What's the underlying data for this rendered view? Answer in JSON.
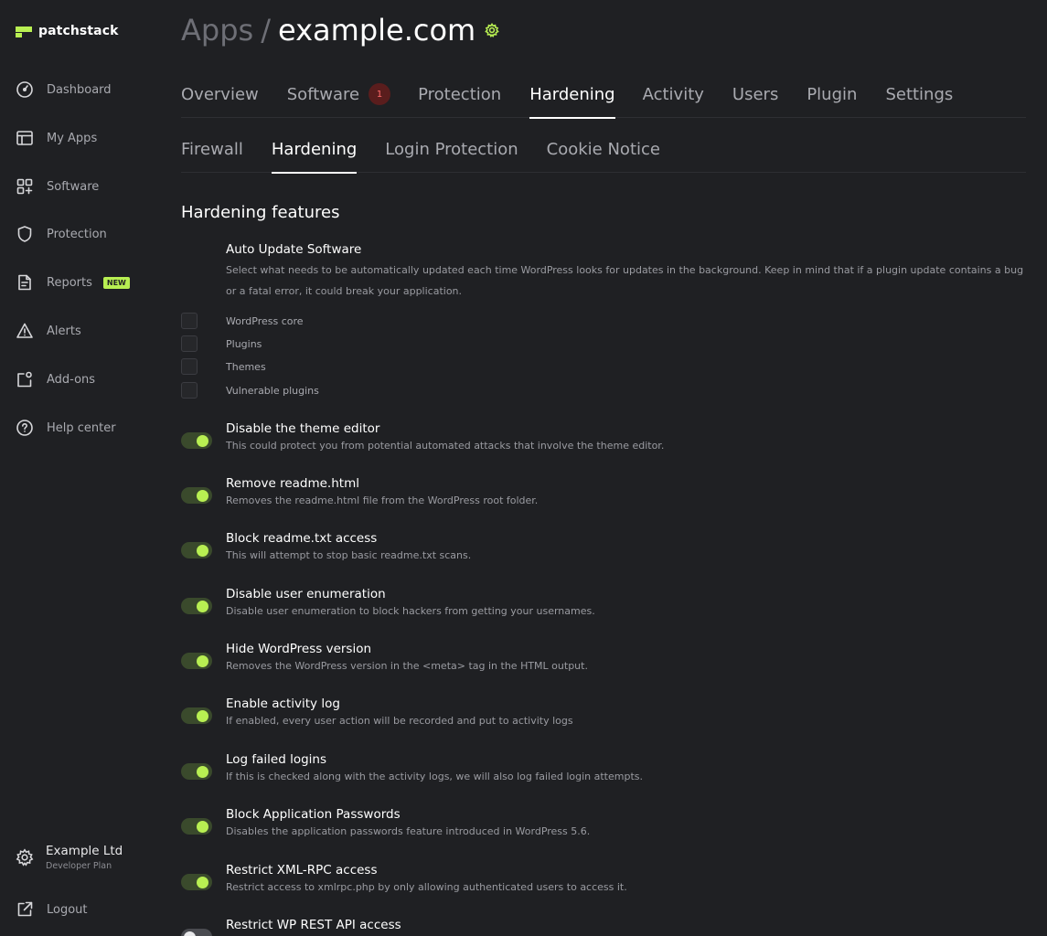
{
  "brand": {
    "name": "patchstack"
  },
  "sidebar": {
    "items": [
      {
        "label": "Dashboard",
        "icon": "dashboard-icon"
      },
      {
        "label": "My Apps",
        "icon": "apps-icon"
      },
      {
        "label": "Software",
        "icon": "software-icon"
      },
      {
        "label": "Protection",
        "icon": "shield-icon"
      },
      {
        "label": "Reports",
        "icon": "report-icon",
        "badge": "NEW"
      },
      {
        "label": "Alerts",
        "icon": "alert-icon"
      },
      {
        "label": "Add-ons",
        "icon": "addons-icon"
      },
      {
        "label": "Help center",
        "icon": "help-icon"
      }
    ],
    "account": {
      "name": "Example Ltd",
      "plan": "Developer Plan"
    },
    "logout": "Logout"
  },
  "header": {
    "crumb_parent": "Apps",
    "crumb_sep": "/",
    "crumb_current": "example.com"
  },
  "tabs": [
    {
      "label": "Overview"
    },
    {
      "label": "Software",
      "count": "1"
    },
    {
      "label": "Protection"
    },
    {
      "label": "Hardening",
      "active": true
    },
    {
      "label": "Activity"
    },
    {
      "label": "Users"
    },
    {
      "label": "Plugin"
    },
    {
      "label": "Settings"
    }
  ],
  "subtabs": [
    {
      "label": "Firewall"
    },
    {
      "label": "Hardening",
      "active": true
    },
    {
      "label": "Login Protection"
    },
    {
      "label": "Cookie Notice"
    }
  ],
  "section_title": "Hardening features",
  "auto_update": {
    "title": "Auto Update Software",
    "desc": "Select what needs to be automatically updated each time WordPress looks for updates in the background. Keep in mind that if a plugin update contains a bug or a fatal error, it could break your application.",
    "options": [
      {
        "label": "WordPress core",
        "checked": false
      },
      {
        "label": "Plugins",
        "checked": false
      },
      {
        "label": "Themes",
        "checked": false
      },
      {
        "label": "Vulnerable plugins",
        "checked": false
      }
    ]
  },
  "features": [
    {
      "title": "Disable the theme editor",
      "desc": "This could protect you from potential automated attacks that involve the theme editor.",
      "enabled": true
    },
    {
      "title": "Remove readme.html",
      "desc": "Removes the readme.html file from the WordPress root folder.",
      "enabled": true
    },
    {
      "title": "Block readme.txt access",
      "desc": "This will attempt to stop basic readme.txt scans.",
      "enabled": true
    },
    {
      "title": "Disable user enumeration",
      "desc": "Disable user enumeration to block hackers from getting your usernames.",
      "enabled": true
    },
    {
      "title": "Hide WordPress version",
      "desc": "Removes the WordPress version in the <meta> tag in the HTML output.",
      "enabled": true
    },
    {
      "title": "Enable activity log",
      "desc": "If enabled, every user action will be recorded and put to activity logs",
      "enabled": true
    },
    {
      "title": "Log failed logins",
      "desc": "If this is checked along with the activity logs, we will also log failed login attempts.",
      "enabled": true
    },
    {
      "title": "Block Application Passwords",
      "desc": "Disables the application passwords feature introduced in WordPress 5.6.",
      "enabled": true
    },
    {
      "title": "Restrict XML-RPC access",
      "desc": "Restrict access to xmlrpc.php by only allowing authenticated users to access it.",
      "enabled": true
    },
    {
      "title": "Restrict WP REST API access",
      "desc": "",
      "enabled": false
    }
  ],
  "colors": {
    "accent": "#b8ef52",
    "background": "#1f2023",
    "danger": "#ff6b6b"
  }
}
